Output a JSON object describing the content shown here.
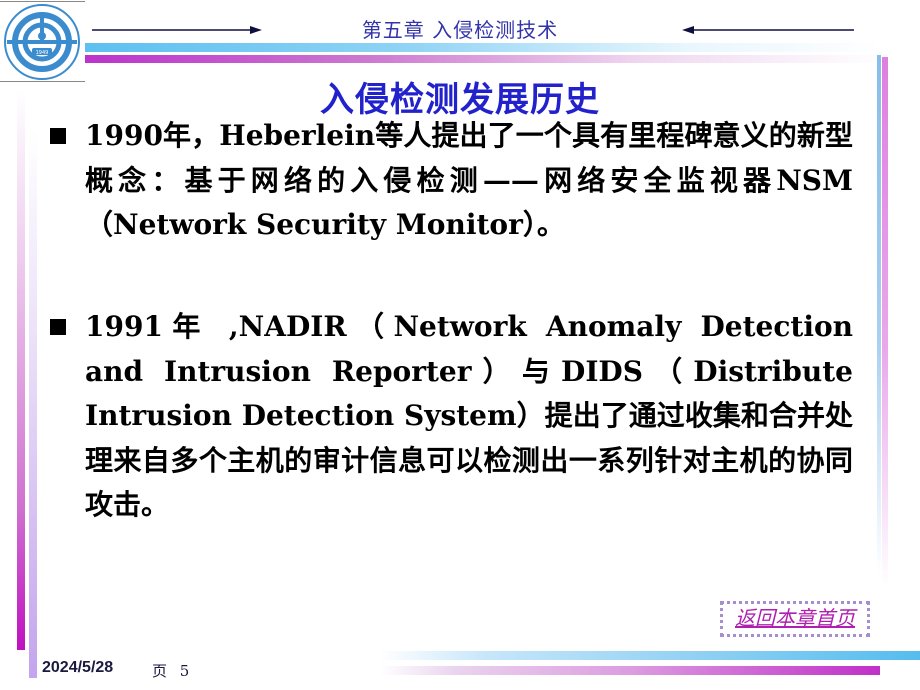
{
  "header": {
    "chapter_title": "第五章  入侵检测技术",
    "logo": {
      "institution": "DALIAN UNIVERSITY OF TECHNOLOGY",
      "year": "1949"
    }
  },
  "slide": {
    "title": "入侵检测发展历史",
    "bullets": [
      {
        "icon": "square-bullet-icon",
        "text": "1990年，Heberlein等人提出了一个具有里程碑意义的新型概念：基于网络的入侵检测——网络安全监视器NSM（Network Security Monitor）。"
      },
      {
        "icon": "square-bullet-icon",
        "text": "1991年 ,NADIR（Network Anomaly Detection and Intrusion Reporter）与DIDS（Distribute Intrusion Detection System）提出了通过收集和合并处理来自多个主机的审计信息可以检测出一系列针对主机的协同攻击。"
      }
    ]
  },
  "navigation": {
    "return_link_label": "返回本章首页"
  },
  "footer": {
    "date": "2024/5/28",
    "page_label": "页 5"
  },
  "colors": {
    "title": "#2222cc",
    "chapter_title": "#3333aa",
    "link": "#b020b0",
    "accent_cyan": "#5cc0f0",
    "accent_magenta": "#c030c8"
  }
}
